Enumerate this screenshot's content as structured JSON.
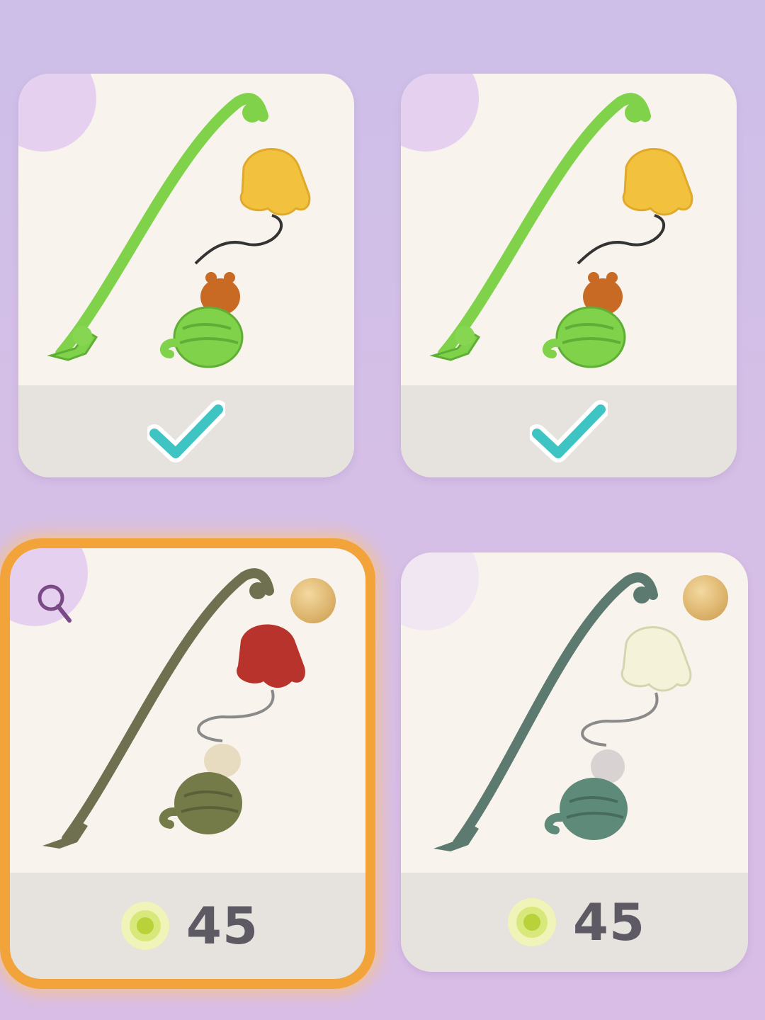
{
  "items": [
    {
      "name": "rod-flower-green",
      "state": "owned"
    },
    {
      "name": "rod-flower-green-2",
      "state": "owned"
    },
    {
      "name": "rod-flower-red",
      "state": "for-sale",
      "selected": true,
      "price": "45"
    },
    {
      "name": "rod-flower-white",
      "state": "for-sale",
      "selected": false,
      "price": "45"
    }
  ],
  "icons": {
    "owned": "checkmark-icon",
    "currency": "flower-coin-icon",
    "preview": "magnifier-icon"
  },
  "colors": {
    "background": "#d4bfe6",
    "card": "#f8f3ec",
    "footer": "#e6e2dd",
    "check": "#3fc4c4",
    "selected_border": "#f2a43a",
    "price_text": "#5e5a63"
  }
}
